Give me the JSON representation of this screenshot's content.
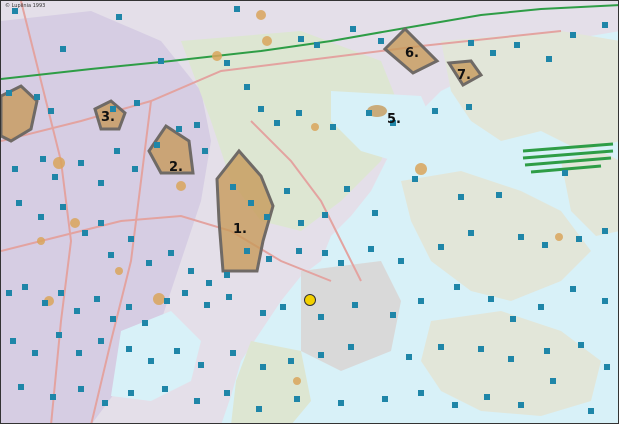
{
  "map": {
    "corner_text": "© Lupiinia 1993",
    "areas": [
      {
        "label": "1."
      },
      {
        "label": "2."
      },
      {
        "label": "3."
      },
      {
        "label": "5."
      },
      {
        "label": "6."
      },
      {
        "label": "7."
      }
    ],
    "colors": {
      "land_urban": "#d9d3e6",
      "land_green": "#dfe7d3",
      "water": "#d8f1f8",
      "site_fill": "#c79a5a",
      "site_outline": "#6f6a66",
      "marker": "#1f86a8",
      "marker_highlight": "#f2d000",
      "railway": "#2e9d46"
    }
  }
}
